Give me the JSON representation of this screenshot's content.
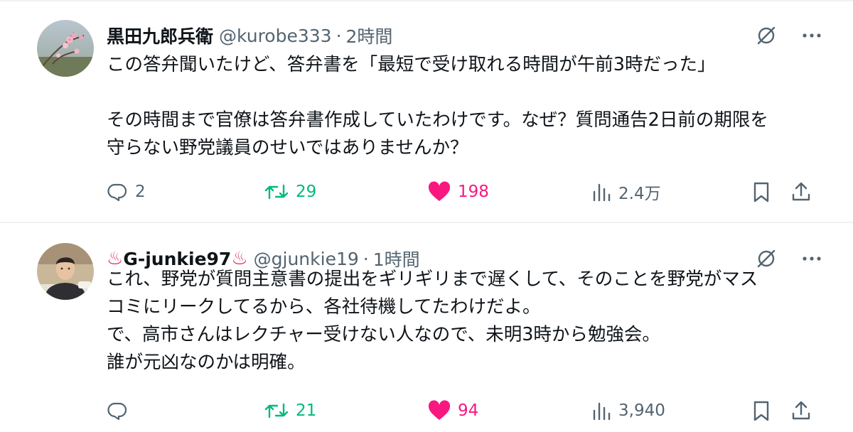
{
  "colors": {
    "text": "#0f1419",
    "muted": "#536471",
    "retweet": "#00ba7c",
    "like": "#f91880",
    "hotspring": "#e0245e",
    "divider": "#eff3f4"
  },
  "posts": [
    {
      "author_name": "黒田九郎兵衛",
      "handle": "@kurobe333",
      "dot": "·",
      "time": "2時間",
      "avatar_icon": "plum-blossom-photo",
      "body": [
        "この答弁聞いたけど、答弁書を「最短で受け取れる時間が午前3時だった」",
        "",
        "その時間まで官僚は答弁書作成していたわけです。なぜ？質問通告2日前の期限を",
        "守らない野党議員のせいではありませんか？"
      ],
      "replies": "2",
      "reposts": "29",
      "likes": "198",
      "views": "2.4万",
      "liked": true
    },
    {
      "author_name_prefix_icon": "♨",
      "author_name": "G-junkie97",
      "author_name_suffix_icon": "♨",
      "handle": "@gjunkie19",
      "dot": "·",
      "time": "1時間",
      "avatar_icon": "man-portrait-photo",
      "body": [
        "これ、野党が質問主意書の提出をギリギリまで遅くして、そのことを野党がマス",
        "コミにリークしてるから、各社待機してたわけだよ。",
        "で、高市さんはレクチャー受けない人なので、未明3時から勉強会。",
        "誰が元凶なのかは明確。"
      ],
      "replies": "",
      "reposts": "21",
      "likes": "94",
      "views": "3,940",
      "liked": true
    }
  ]
}
